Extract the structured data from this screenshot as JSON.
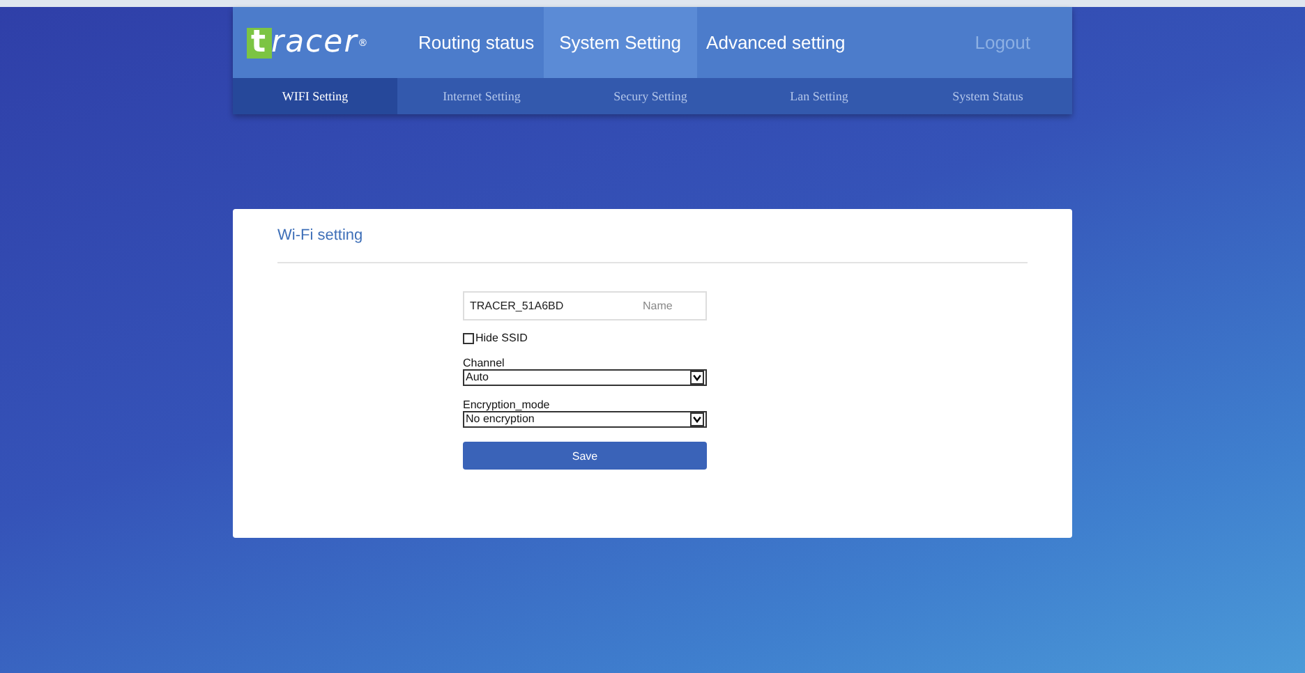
{
  "logo": {
    "mark": "t",
    "text": "racer",
    "reg": "®"
  },
  "nav": [
    {
      "label": "Routing status",
      "selected": false
    },
    {
      "label": "System Setting",
      "selected": true
    },
    {
      "label": "Advanced setting",
      "selected": false
    }
  ],
  "logout": "Logout",
  "subnav": [
    {
      "label": "WIFI Setting",
      "selected": true
    },
    {
      "label": "Internet Setting",
      "selected": false
    },
    {
      "label": "Secury Setting",
      "selected": false
    },
    {
      "label": "Lan Setting",
      "selected": false
    },
    {
      "label": "System Status",
      "selected": false
    }
  ],
  "card": {
    "title": "Wi-Fi setting",
    "ssid": {
      "value": "TRACER_51A6BD",
      "label": "Name"
    },
    "hide_ssid": {
      "label": "Hide SSID",
      "checked": false
    },
    "channel": {
      "label": "Channel",
      "value": "Auto"
    },
    "encryption": {
      "label": "Encryption_mode",
      "value": "No encryption"
    },
    "save": "Save"
  }
}
